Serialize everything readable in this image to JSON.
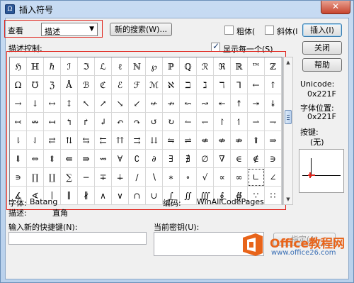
{
  "window": {
    "title": "插入符号",
    "close_symbol": "✕",
    "app_icon_glyph": "Ω"
  },
  "top_row": {
    "view_label": "查看",
    "view_value": "描述",
    "search_button": "新的搜索(W)...",
    "bold_label": "粗体(",
    "italic_label": "斜体(I",
    "insert_button": "插入(I)"
  },
  "grid_section": {
    "control_label": "描述控制:",
    "show_each_label": "显示每一个(S)",
    "show_each_checked": true,
    "rows": [
      [
        "ℌ",
        "ℍ",
        "ℏ",
        "ℐ",
        "ℑ",
        "ℒ",
        "ℓ",
        "ℕ",
        "℘",
        "ℙ",
        "ℚ",
        "ℛ",
        "ℜ",
        "ℝ",
        "™",
        "ℤ"
      ],
      [
        "Ω",
        "℧",
        "ℨ",
        "Å",
        "ℬ",
        "ℭ",
        "ℰ",
        "ℱ",
        "ℳ",
        "ℵ",
        "ℶ",
        "ℷ",
        "ℸ",
        "⅂",
        "←",
        "↑"
      ],
      [
        "→",
        "↓",
        "↔",
        "↕",
        "↖",
        "↗",
        "↘",
        "↙",
        "↚",
        "↛",
        "↜",
        "↝",
        "↞",
        "↟",
        "↠",
        "↡"
      ],
      [
        "↢",
        "↭",
        "↤",
        "↰",
        "↱",
        "↲",
        "↶",
        "↷",
        "↺",
        "↻",
        "↼",
        "↽",
        "↾",
        "↿",
        "⇀",
        "⇁"
      ],
      [
        "⇂",
        "⇃",
        "⇄",
        "⇅",
        "⇆",
        "⇇",
        "⇈",
        "⇉",
        "⇊",
        "⇋",
        "⇌",
        "⇍",
        "⇎",
        "⇏",
        "⇑",
        "⇒"
      ],
      [
        "⇓",
        "⇔",
        "⇕",
        "⇚",
        "⇛",
        "⇝",
        "∀",
        "∁",
        "∂",
        "∃",
        "∄",
        "∅",
        "∇",
        "∈",
        "∉",
        "∋"
      ],
      [
        "∍",
        "∏",
        "∐",
        "∑",
        "−",
        "∓",
        "∔",
        "∕",
        "∖",
        "∗",
        "∘",
        "√",
        "∝",
        "∞",
        "∟",
        "∠"
      ],
      [
        "∡",
        "∢",
        "∣",
        "∥",
        "∦",
        "∧",
        "∨",
        "∩",
        "∪",
        "∫",
        "∬",
        "∭",
        "∮",
        "∯",
        "∵",
        "∷"
      ]
    ],
    "selected_row": 6,
    "selected_col": 14
  },
  "right_panel": {
    "close_button": "关闭",
    "help_button": "帮助",
    "unicode_label": "Unicode:",
    "unicode_value": "0x221F",
    "font_pos_label": "字体位置:",
    "font_pos_value": "0x221F",
    "key_label": "按键:",
    "key_value": "(无)"
  },
  "info": {
    "font_label": "字体:",
    "font_value": "Batang",
    "encoding_label": "编码:",
    "encoding_value": "WinAllCodePages",
    "desc_label": "描述:",
    "desc_value": "直角"
  },
  "bottom": {
    "new_shortcut_label": "输入新的快捷键(N):",
    "new_shortcut_value": "",
    "current_key_label": "当前密钥(U):",
    "current_key_value": "",
    "assign_button": "指定(A)"
  },
  "watermark": {
    "title": "Office教程网",
    "url": "www.office26.com",
    "logo_color": "#e8641a"
  },
  "colors": {
    "highlight_border": "#e0241c",
    "window_frame": "#b9d1ec"
  }
}
